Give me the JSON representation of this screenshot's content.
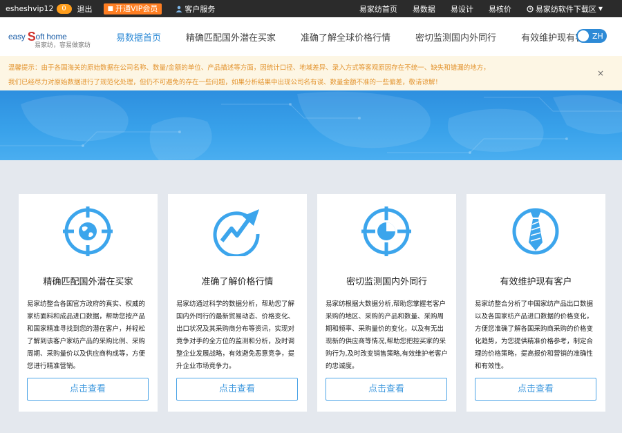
{
  "topbar": {
    "username": "esheshvip12",
    "coins": "0",
    "logout": "退出",
    "vip_label": "开通VIP会员",
    "service_label": "客户服务",
    "links": [
      "易家纺首页",
      "易数据",
      "易设计",
      "易核价"
    ],
    "download_label": "易家纺软件下载区"
  },
  "brand": {
    "logo_text_a": "easy",
    "logo_text_s": "S",
    "logo_text_b": "oft home",
    "slogan": "易家纺，容易做家纺"
  },
  "nav": {
    "items": [
      "易数据首页",
      "精确匹配国外潜在买家",
      "准确了解全球价格行情",
      "密切监测国内外同行",
      "有效维护现有客户"
    ],
    "active_index": 0,
    "lang": "ZH"
  },
  "notice": {
    "line1": "温馨提示：由于各国海关的原始数据在公司名称、数量/金额的单位、产品描述等方面，因统计口径、地域差异、录入方式等客观原因存在不统一、缺失和错漏的地方，",
    "line2": "我们已经尽力对原始数据进行了规范化处理，但仍不可避免的存在一些问题，如果分析结果中出现公司名有误、数量金额不准的一些偏差，敬请谅解！",
    "close": "×"
  },
  "colors": {
    "accent": "#2d8ad6",
    "icon_blue": "#3ca5ec",
    "vip_orange": "#ff7e22",
    "notice_text": "#e3942f"
  },
  "cards": [
    {
      "icon": "globe-target-icon",
      "title": "精确匹配国外潜在买家",
      "desc": "易家纺整合各国官方政府的真实、权威的家纺面料和成品进口数据，帮助您按产品和国家精准寻找到您的潜在客户，并轻松了解到该客户家纺产品的采购比例、采购周期、采购量价以及供应商构成等，方便您进行精准营销。",
      "button": "点击查看"
    },
    {
      "icon": "trend-arrow-icon",
      "title": "准确了解价格行情",
      "desc": "易家纺通过科学的数据分析，帮助您了解国内外同行的最新贸易动态、价格变化、出口状况及其采购商分布等资讯，实现对竞争对手的全方位的监测和分析，及时调整企业发展战略，有效避免恶意竞争，提升企业市场竞争力。",
      "button": "点击查看"
    },
    {
      "icon": "crosshair-icon",
      "title": "密切监测国内外同行",
      "desc": "易家纺根据大数据分析,帮助您掌握老客户采购的地区、采购的产品和数量、采购周期和频率、采购量价的变化，以及有无出现新的供应商等情况,帮助您把控买家的采购行为,及时改变销售策略,有效维护老客户的忠诚度。",
      "button": "点击查看"
    },
    {
      "icon": "tie-icon",
      "title": "有效维护现有客户",
      "desc": "易家纺整合分析了中国家纺产品出口数据以及各国家纺产品进口数据的价格变化，方便您准确了解各国采购商采购的价格变化趋势，为您提供精准价格参考，制定合理的价格策略，提高报价和营销的准确性和有效性。",
      "button": "点击查看"
    }
  ]
}
